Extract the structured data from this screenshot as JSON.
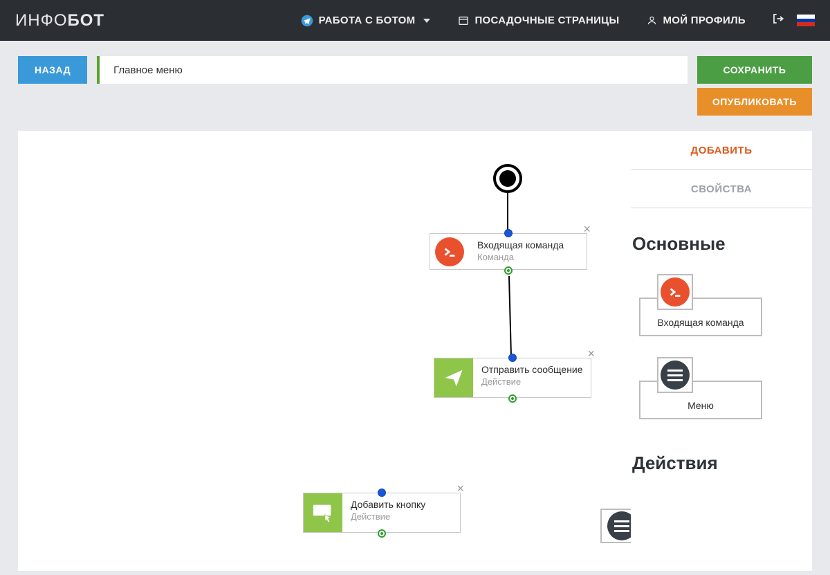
{
  "brand": {
    "part1": "ИНФО",
    "part2": "БОТ"
  },
  "nav": {
    "work_with_bot": "РАБОТА С БОТОМ",
    "landing_pages": "ПОСАДОЧНЫЕ СТРАНИЦЫ",
    "profile": "МОЙ ПРОФИЛЬ"
  },
  "toolbar": {
    "back": "НАЗАД",
    "title": "Главное меню",
    "save": "СОХРАНИТЬ",
    "publish": "ОПУБЛИКОВАТЬ"
  },
  "side": {
    "tab_add": "ДОБАВИТЬ",
    "tab_props": "СВОЙСТВА",
    "section_main": "Основные",
    "section_actions": "Действия",
    "palette": {
      "incoming_cmd": "Входящая команда",
      "menu": "Меню"
    }
  },
  "nodes": {
    "incoming": {
      "title": "Входящая команда",
      "sub": "Команда"
    },
    "send": {
      "title": "Отправить сообщение",
      "sub": "Действие"
    },
    "addbtn": {
      "title": "Добавить кнопку",
      "sub": "Действие"
    }
  }
}
